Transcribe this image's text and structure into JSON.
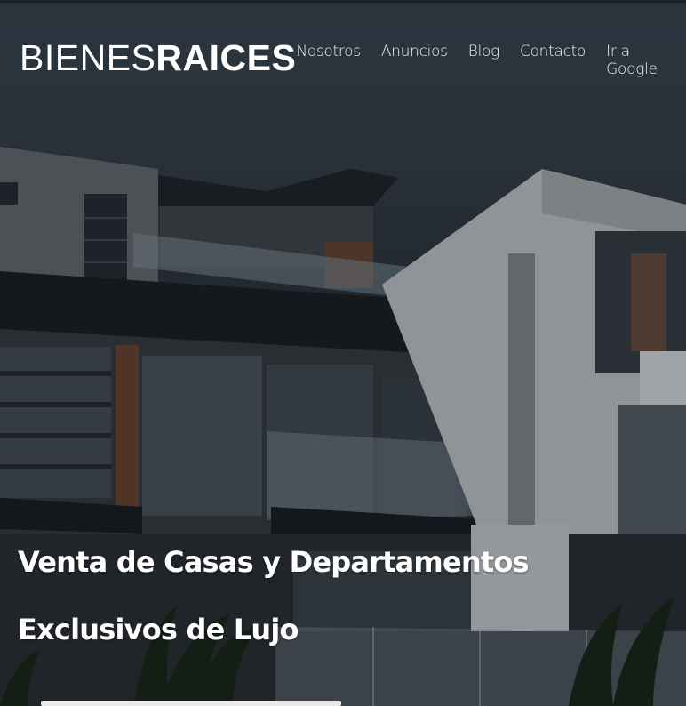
{
  "header": {
    "logo_light": "BIENES",
    "logo_bold": "RAICES",
    "nav": [
      {
        "label": "Nosotros"
      },
      {
        "label": "Anuncios"
      },
      {
        "label": "Blog"
      },
      {
        "label": "Contacto"
      },
      {
        "label": "Ir a Google"
      }
    ]
  },
  "hero": {
    "line1": "Venta de Casas y Departamentos",
    "line2": "Exclusivos de Lujo",
    "image_alt": "modern-luxury-house-photo"
  },
  "colors": {
    "text": "#ffffff",
    "overlay": "#000000"
  }
}
